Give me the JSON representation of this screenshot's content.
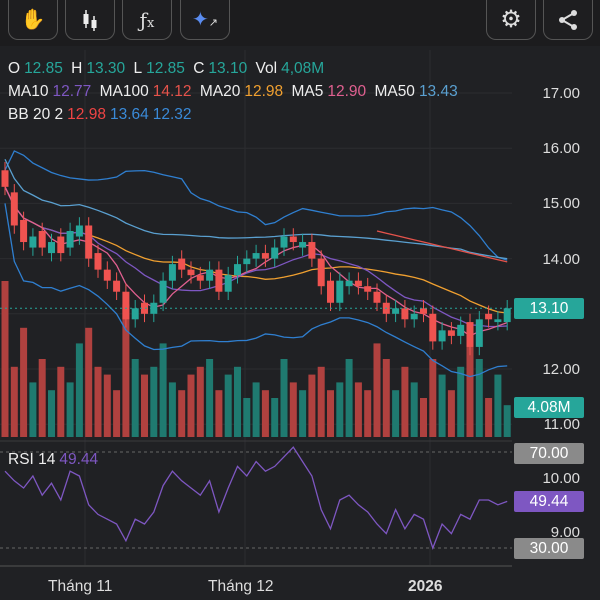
{
  "toolbar": {
    "left": [
      {
        "name": "hand-tool",
        "glyph": "✋"
      },
      {
        "name": "candlestick-type",
        "glyph": "candles"
      },
      {
        "name": "indicators",
        "glyph": "fx"
      },
      {
        "name": "ai-analysis",
        "glyph": "✦"
      }
    ],
    "right": [
      {
        "name": "settings",
        "glyph": "⚙"
      },
      {
        "name": "share",
        "glyph": "share"
      }
    ]
  },
  "ohlc": {
    "o_label": "O",
    "o": "12.85",
    "h_label": "H",
    "h": "13.30",
    "l_label": "L",
    "l": "12.85",
    "c_label": "C",
    "c": "13.10",
    "vol_label": "Vol",
    "vol": "4,08M"
  },
  "ma": {
    "ma10_label": "MA10",
    "ma10": "12.77",
    "ma100_label": "MA100",
    "ma100": "14.12",
    "ma20_label": "MA20",
    "ma20": "12.98",
    "ma5_label": "MA5",
    "ma5": "12.90",
    "ma50_label": "MA50",
    "ma50": "13.43"
  },
  "bb": {
    "label": "BB 20 2",
    "mid": "12.98",
    "upper": "13.64",
    "lower": "12.32"
  },
  "rsi": {
    "label": "RSI 14",
    "value": "49.44"
  },
  "colors": {
    "up": "#26a69a",
    "down": "#ef5350",
    "ma10": "#7e57c2",
    "ma100": "#e5534b",
    "ma20": "#f0a030",
    "ma5": "#e06090",
    "ma50": "#5aa0d0",
    "bb": "#2f7fd0",
    "rsi": "#7e57c2"
  },
  "chart_data": {
    "type": "candlestick",
    "price_axis": [
      "17.00",
      "16.00",
      "15.00",
      "14.00",
      "13.00",
      "12.00",
      "11.00"
    ],
    "price_range": [
      11,
      17
    ],
    "last_price": "13.10",
    "last_volume": "4.08M",
    "rsi_axis": {
      "upper": "70.00",
      "lower": "30.00",
      "extra": [
        "10.00",
        "9.00"
      ]
    },
    "x_labels": [
      "Tháng 11",
      "Tháng 12",
      "2026"
    ],
    "close": [
      15.3,
      14.6,
      14.3,
      14.4,
      14.2,
      14.3,
      14.1,
      14.5,
      14.6,
      14.0,
      13.8,
      13.6,
      13.4,
      12.9,
      13.1,
      13.0,
      13.2,
      13.6,
      13.9,
      13.8,
      13.7,
      13.6,
      13.8,
      13.4,
      13.7,
      13.9,
      14.0,
      14.1,
      14.0,
      14.2,
      14.4,
      14.3,
      14.3,
      14.0,
      13.5,
      13.2,
      13.6,
      13.6,
      13.5,
      13.4,
      13.2,
      13.0,
      13.1,
      12.9,
      13.0,
      13.0,
      12.5,
      12.7,
      12.6,
      12.8,
      12.4,
      12.9,
      12.9,
      12.9,
      13.1
    ],
    "open": [
      15.6,
      15.2,
      14.7,
      14.2,
      14.5,
      14.1,
      14.4,
      14.2,
      14.4,
      14.6,
      14.1,
      13.8,
      13.6,
      13.4,
      12.9,
      13.2,
      13.0,
      13.2,
      13.6,
      14.0,
      13.8,
      13.7,
      13.6,
      13.8,
      13.4,
      13.7,
      13.9,
      14.0,
      14.1,
      14.0,
      14.2,
      14.4,
      14.2,
      14.3,
      14.0,
      13.6,
      13.2,
      13.5,
      13.6,
      13.5,
      13.4,
      13.2,
      13.0,
      13.1,
      12.9,
      13.1,
      13.0,
      12.5,
      12.7,
      12.6,
      12.85,
      12.4,
      13.0,
      12.85,
      12.85
    ],
    "volume": [
      20,
      9,
      14,
      7,
      10,
      6,
      9,
      7,
      12,
      14,
      9,
      8,
      6,
      17,
      10,
      8,
      9,
      12,
      7,
      6,
      8,
      9,
      10,
      6,
      8,
      9,
      5,
      7,
      6,
      5,
      10,
      7,
      6,
      8,
      9,
      6,
      7,
      10,
      7,
      6,
      12,
      10,
      6,
      9,
      7,
      5,
      10,
      8,
      6,
      9,
      13,
      10,
      5,
      8,
      4.08
    ],
    "rsi": [
      62,
      58,
      55,
      60,
      52,
      57,
      50,
      62,
      60,
      48,
      44,
      42,
      40,
      33,
      42,
      40,
      45,
      56,
      62,
      58,
      55,
      52,
      58,
      45,
      55,
      64,
      60,
      66,
      62,
      64,
      68,
      72,
      66,
      60,
      46,
      38,
      50,
      52,
      48,
      45,
      40,
      36,
      46,
      38,
      44,
      42,
      30,
      40,
      36,
      44,
      42,
      50,
      50,
      48,
      49.44
    ]
  }
}
